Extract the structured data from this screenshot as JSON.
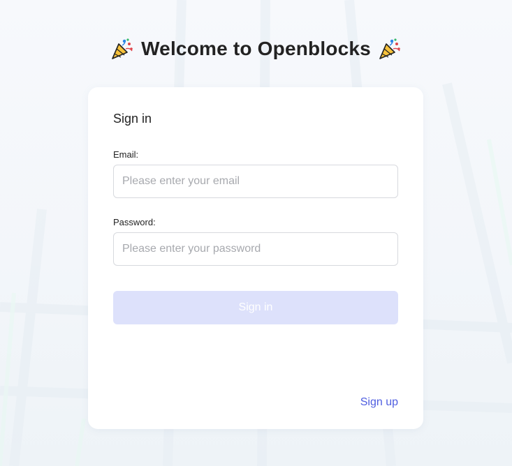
{
  "page": {
    "heading": "Welcome to Openblocks",
    "heading_icon": "party-popper-icon"
  },
  "login_card": {
    "title": "Sign in",
    "email": {
      "label": "Email:",
      "value": "",
      "placeholder": "Please enter your email"
    },
    "password": {
      "label": "Password:",
      "value": "",
      "placeholder": "Please enter your password"
    },
    "submit_label": "Sign in",
    "submit_state": "disabled",
    "signup_label": "Sign up"
  },
  "colors": {
    "accent_link": "#4f5ee0",
    "button_disabled_bg": "#dde1fb",
    "card_bg": "#ffffff",
    "page_bg": "#f5f8fb"
  }
}
